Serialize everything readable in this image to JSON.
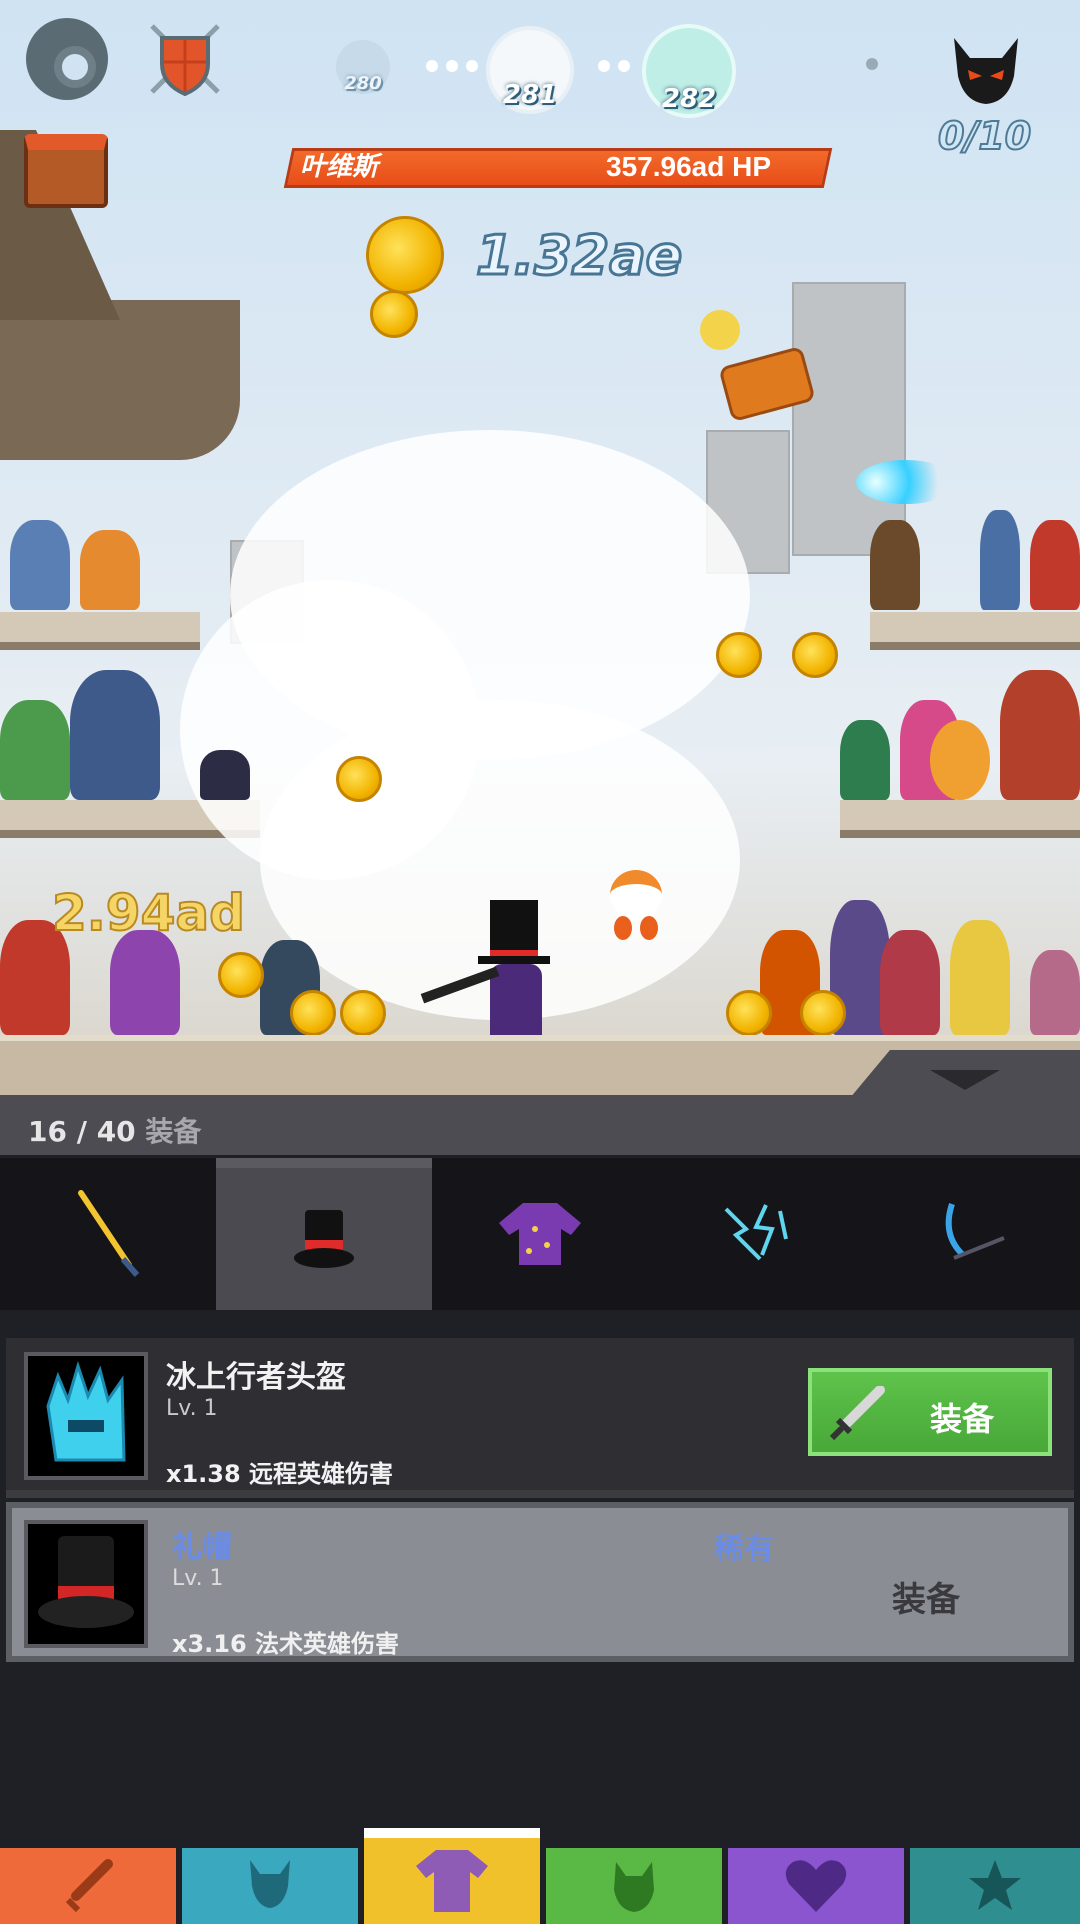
{
  "hud": {
    "stages": [
      "280",
      "281",
      "282"
    ],
    "boss_counter": "0/10",
    "boss_name": "叶维斯",
    "boss_hp": "357.96ad HP",
    "gold": "1.32ae",
    "damage_popup": "2.94ad"
  },
  "equipment": {
    "count": "16 / 40",
    "count_label": "装备",
    "tabs": [
      {
        "icon": "sword-icon"
      },
      {
        "icon": "top-hat-icon",
        "active": true
      },
      {
        "icon": "robe-icon"
      },
      {
        "icon": "lightning-icon"
      },
      {
        "icon": "blue-sword-icon"
      }
    ],
    "items": [
      {
        "name": "冰上行者头盔",
        "level": "Lv. 1",
        "effect": "x1.38 远程英雄伤害",
        "button": "装备",
        "icon": "ice-helmet-icon"
      },
      {
        "name": "礼帽",
        "level": "Lv. 1",
        "effect": "x3.16 法术英雄伤害",
        "rarity": "稀有",
        "button": "装备",
        "icon": "top-hat-icon"
      }
    ]
  },
  "nav": {
    "tabs": [
      {
        "icon": "sword-icon",
        "color": "#ee6a3a"
      },
      {
        "icon": "hero-icon",
        "color": "#3aa8be"
      },
      {
        "icon": "shirt-icon",
        "color": "#f0c12a",
        "active": true
      },
      {
        "icon": "pet-icon",
        "color": "#59b944"
      },
      {
        "icon": "heart-icon",
        "color": "#8a55cf"
      },
      {
        "icon": "star-icon",
        "color": "#2e8e90"
      }
    ]
  }
}
